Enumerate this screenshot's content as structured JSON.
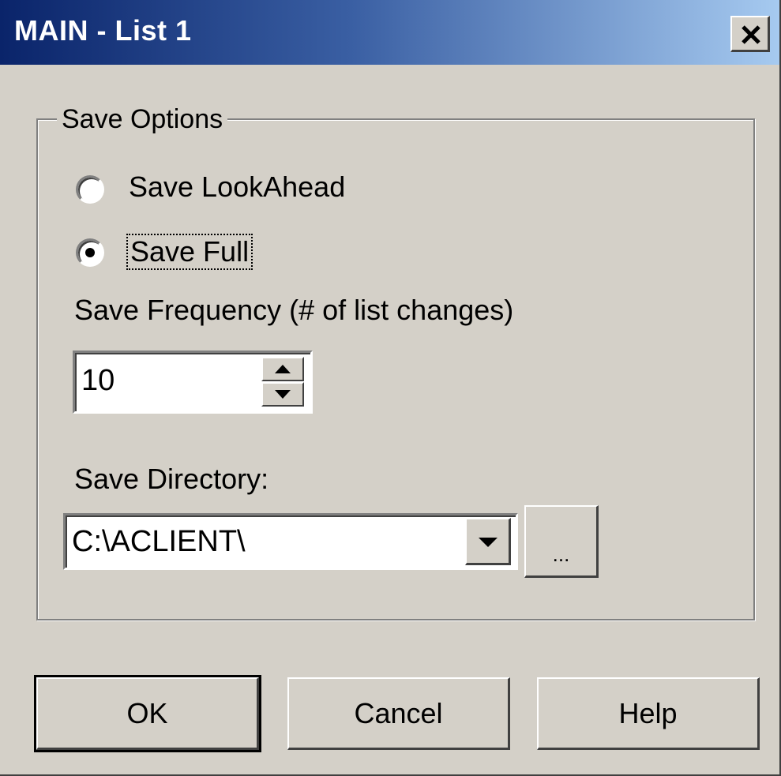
{
  "window": {
    "title": "MAIN - List 1",
    "close_icon": "close-icon"
  },
  "save_options": {
    "group_label": "Save Options",
    "radios": [
      {
        "label": "Save LookAhead",
        "selected": false
      },
      {
        "label": "Save Full",
        "selected": true
      }
    ],
    "frequency_label": "Save Frequency (# of list changes)",
    "frequency_value": "10",
    "directory_label": "Save Directory:",
    "directory_value": "C:\\ACLIENT\\",
    "browse_label": "..."
  },
  "buttons": {
    "ok": "OK",
    "cancel": "Cancel",
    "help": "Help"
  },
  "colors": {
    "face": "#d4d0c8",
    "title_start": "#0a246a",
    "title_end": "#a6caf0"
  }
}
